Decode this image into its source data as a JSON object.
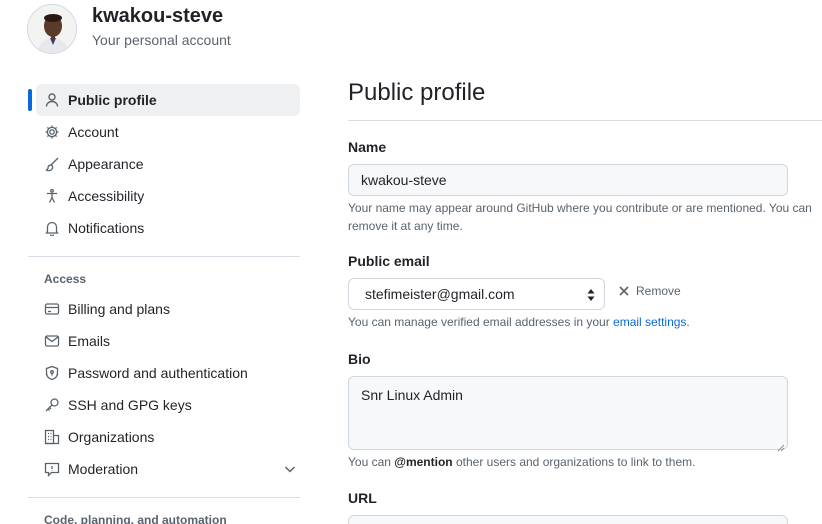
{
  "account": {
    "name": "kwakou-steve",
    "subtitle": "Your personal account"
  },
  "sidebar": {
    "items": [
      {
        "label": "Public profile",
        "icon": "person-icon",
        "active": true
      },
      {
        "label": "Account",
        "icon": "gear-icon"
      },
      {
        "label": "Appearance",
        "icon": "paintbrush-icon"
      },
      {
        "label": "Accessibility",
        "icon": "accessibility-icon"
      },
      {
        "label": "Notifications",
        "icon": "bell-icon"
      }
    ],
    "access_title": "Access",
    "access_items": [
      {
        "label": "Billing and plans",
        "icon": "credit-card-icon"
      },
      {
        "label": "Emails",
        "icon": "mail-icon"
      },
      {
        "label": "Password and authentication",
        "icon": "shield-lock-icon"
      },
      {
        "label": "SSH and GPG keys",
        "icon": "key-icon"
      },
      {
        "label": "Organizations",
        "icon": "organization-icon"
      },
      {
        "label": "Moderation",
        "icon": "report-icon"
      }
    ],
    "code_title": "Code, planning, and automation"
  },
  "main": {
    "title": "Public profile",
    "name_label": "Name",
    "name_value": "kwakou-steve",
    "name_note": "Your name may appear around GitHub where you contribute or are mentioned. You can remove it at any time.",
    "email_label": "Public email",
    "email_value": "stefimeister@gmail.com",
    "remove_label": "Remove",
    "email_note_prefix": "You can manage verified email addresses in your ",
    "email_note_link": "email settings",
    "email_note_suffix": ".",
    "bio_label": "Bio",
    "bio_value": "Snr Linux Admin",
    "bio_note_prefix": "You can ",
    "bio_note_mention": "@mention",
    "bio_note_suffix": " other users and organizations to link to them.",
    "url_label": "URL"
  },
  "colors": {
    "accent": "#0969da",
    "active_bg": "#eef0f2",
    "text_muted": "#59636e"
  }
}
